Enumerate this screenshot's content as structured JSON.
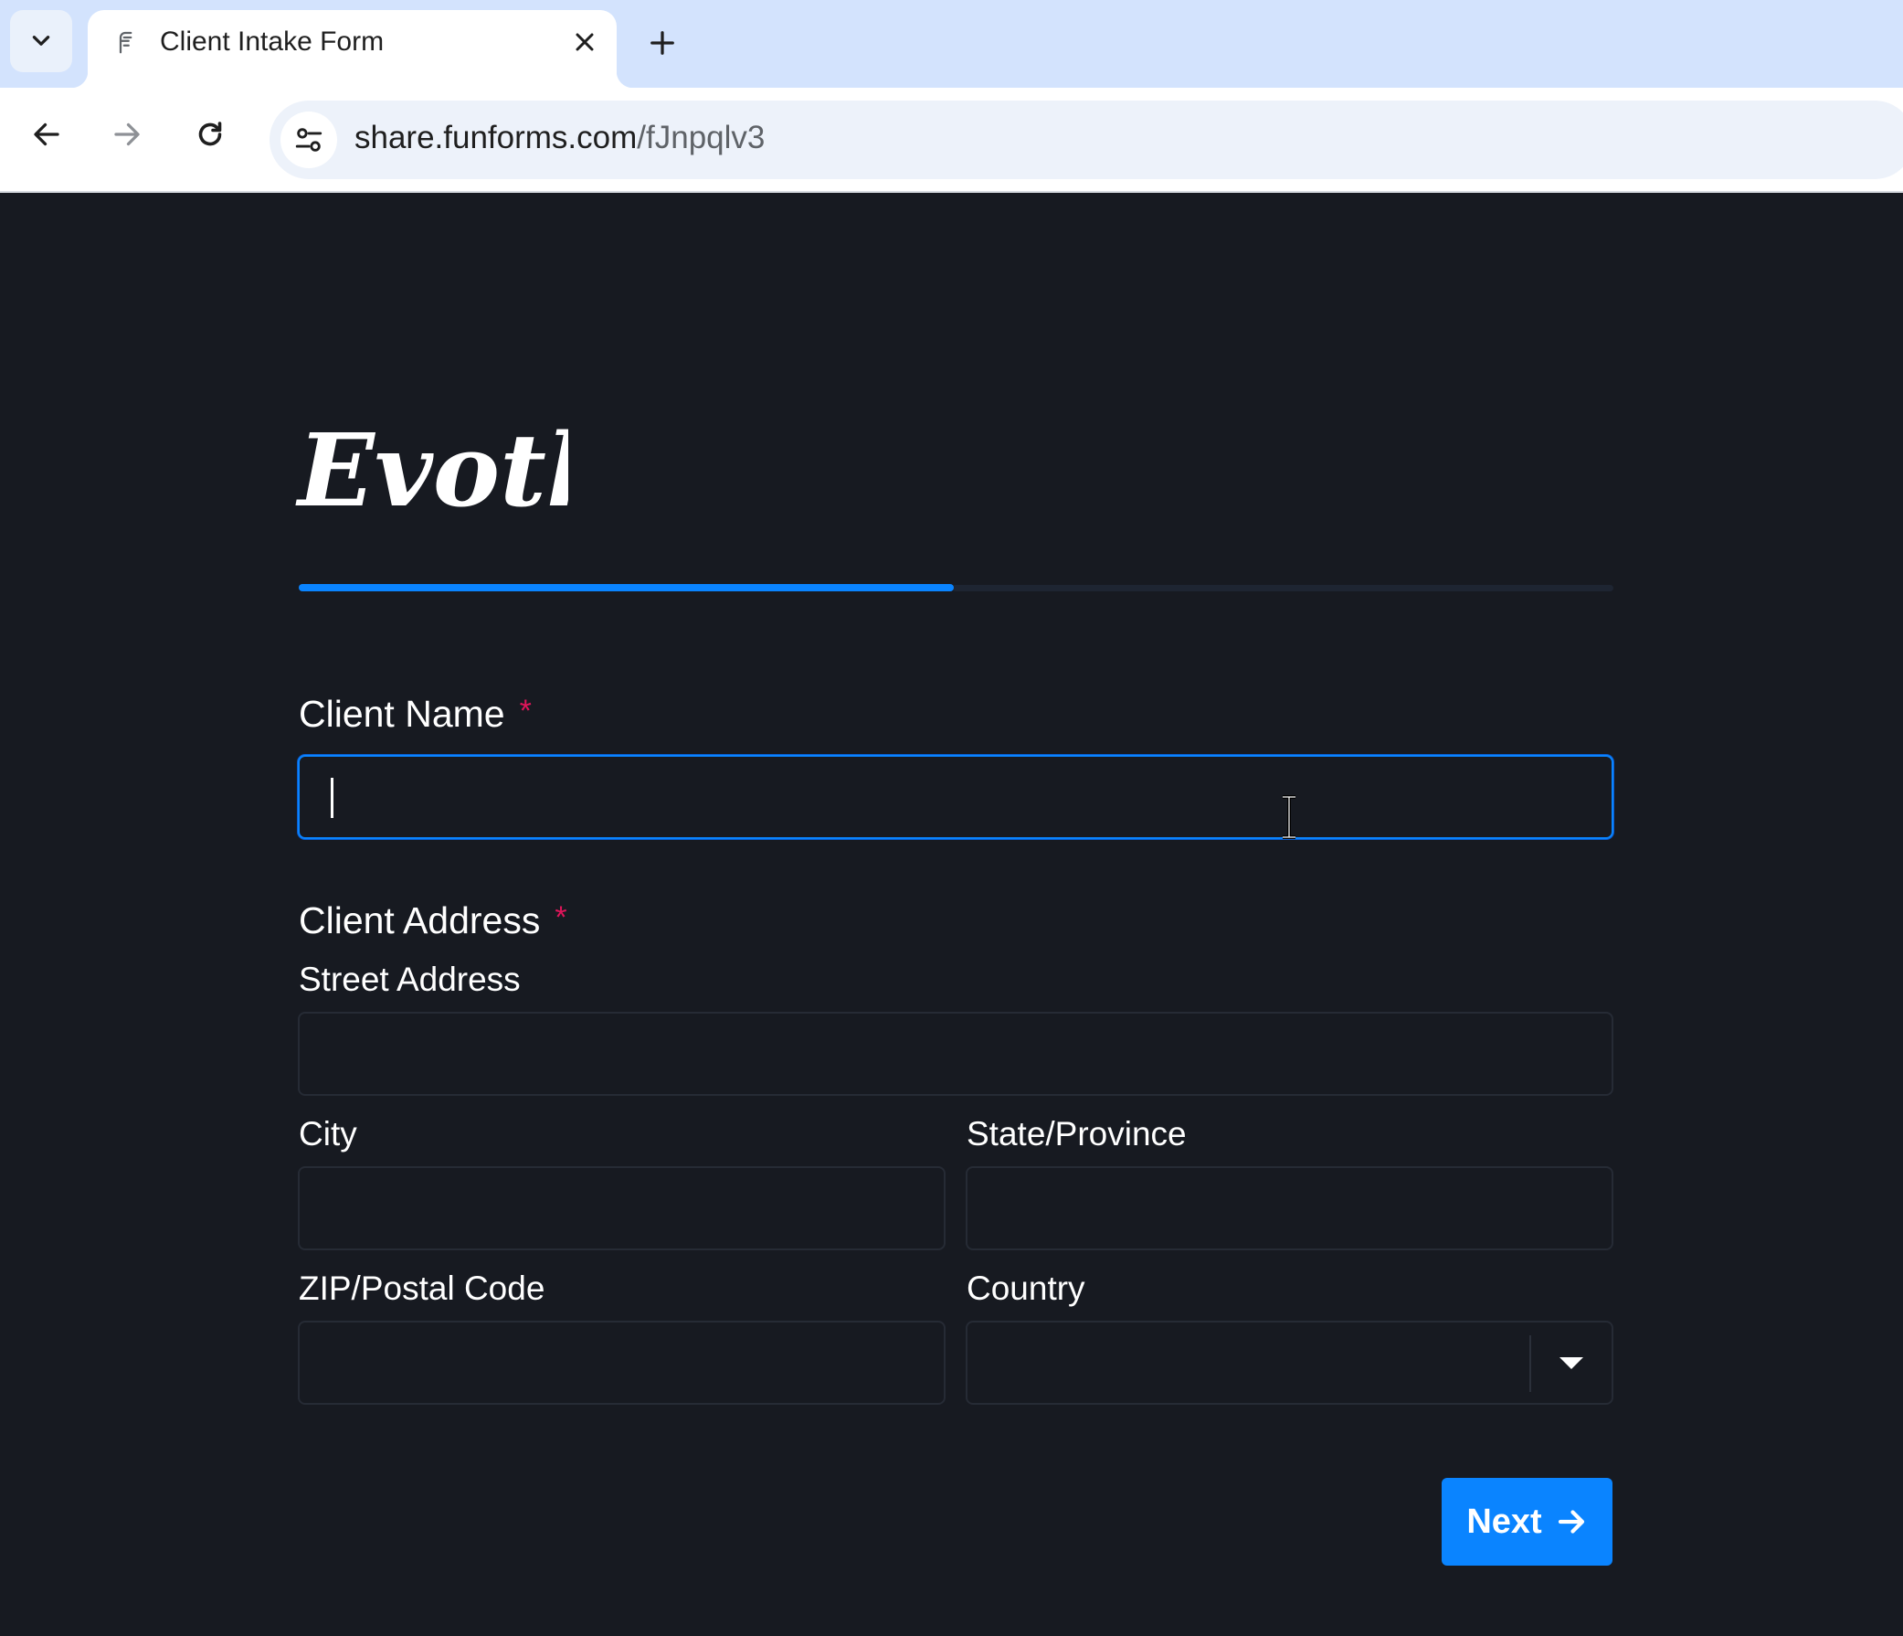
{
  "browser": {
    "tab": {
      "title": "Client Intake Form"
    },
    "address": {
      "host": "share.funforms.com",
      "path": "/fJnpqlv3"
    }
  },
  "form": {
    "logo_text": "Evothe",
    "progress_fraction": 0.5,
    "client_name": {
      "label": "Client Name",
      "required_mark": "*",
      "value": ""
    },
    "client_address": {
      "label": "Client Address",
      "required_mark": "*",
      "street": {
        "label": "Street Address",
        "value": ""
      },
      "city": {
        "label": "City",
        "value": ""
      },
      "state": {
        "label": "State/Province",
        "value": ""
      },
      "zip": {
        "label": "ZIP/Postal Code",
        "value": ""
      },
      "country": {
        "label": "Country",
        "value": ""
      }
    },
    "next_label": "Next"
  },
  "colors": {
    "accent": "#0a84ff",
    "required": "#e0155a",
    "page_bg": "#171a21"
  },
  "icons": [
    "chevron-down-icon",
    "form-favicon-icon",
    "close-icon",
    "plus-icon",
    "back-arrow-icon",
    "forward-arrow-icon",
    "reload-icon",
    "site-settings-icon",
    "text-cursor-icon",
    "caret-down-icon",
    "arrow-right-icon"
  ]
}
